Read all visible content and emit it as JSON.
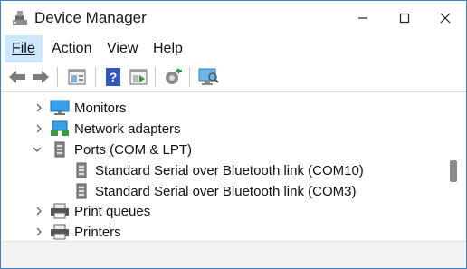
{
  "window": {
    "title": "Device Manager"
  },
  "menu": {
    "file": "File",
    "action": "Action",
    "view": "View",
    "help": "Help"
  },
  "toolbar": {
    "buttons": [
      "back-icon",
      "forward-icon",
      "properties-icon",
      "help-icon",
      "run-icon",
      "update-driver-icon",
      "scan-hardware-icon"
    ]
  },
  "tree": {
    "monitors": "Monitors",
    "network_adapters": "Network adapters",
    "ports": "Ports (COM & LPT)",
    "port_com10": "Standard Serial over Bluetooth link (COM10)",
    "port_com3": "Standard Serial over Bluetooth link (COM3)",
    "print_queues": "Print queues",
    "printers": "Printers"
  },
  "colors": {
    "accent": "#0078d4",
    "menu_active": "#cce8ff",
    "window_border": "#3f7ec9"
  }
}
